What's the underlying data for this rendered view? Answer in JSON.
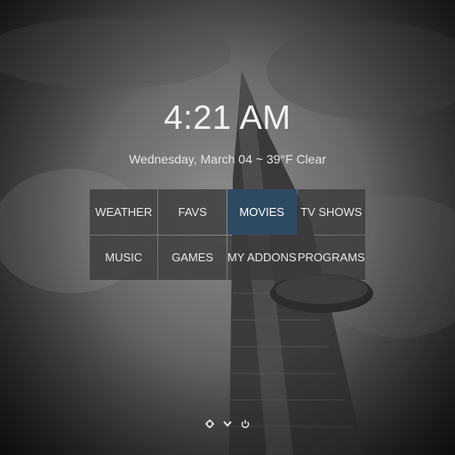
{
  "clock": {
    "time": "4:21 AM"
  },
  "status": {
    "date_weather": "Wednesday, March 04 ~ 39°F Clear"
  },
  "menu": {
    "items": [
      {
        "label": "WEATHER"
      },
      {
        "label": "FAVS"
      },
      {
        "label": "MOVIES"
      },
      {
        "label": "TV SHOWS"
      },
      {
        "label": "MUSIC"
      },
      {
        "label": "GAMES"
      },
      {
        "label": "MY ADDONS"
      },
      {
        "label": "PROGRAMS"
      }
    ],
    "selected_label": "MOVIES"
  },
  "footer": {
    "icons": [
      "gear-icon",
      "chevron-down-icon",
      "power-icon"
    ]
  },
  "colors": {
    "tile_bg": "#3c3c3c",
    "tile_selected": "#2e4a63",
    "text": "#e8e8e8"
  }
}
